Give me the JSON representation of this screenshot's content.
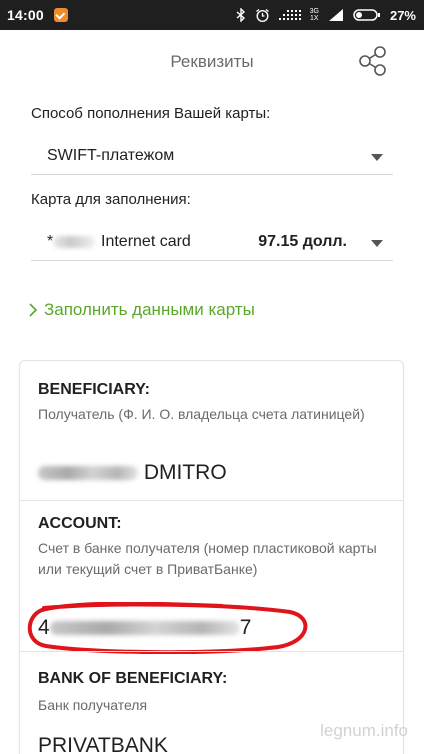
{
  "status_bar": {
    "time": "14:00",
    "network_top": "3G",
    "network_bottom": "1X",
    "battery": "27%"
  },
  "header": {
    "title": "Реквизиты"
  },
  "form": {
    "method_label": "Способ пополнения Вашей карты:",
    "method_value": "SWIFT-платежом",
    "card_label": "Карта для заполнения:",
    "card_prefix": "*",
    "card_name": "Internet card",
    "card_amount": "97.15 долл."
  },
  "fill_link": {
    "label": "Заполнить данными карты"
  },
  "details": {
    "beneficiary": {
      "title": "BENEFICIARY:",
      "description": "Получатель (Ф. И. О. владельца счета латиницей)",
      "value": "DMITRO"
    },
    "account": {
      "title": "ACCOUNT:",
      "description": "Счет в банке получателя (номер пластиковой карты или текущий счет в ПриватБанке)",
      "value_first": "4",
      "value_last": "7"
    },
    "bank": {
      "title": "BANK OF BENEFICIARY:",
      "description": "Банк получателя",
      "value": "PRIVATBANK"
    }
  },
  "watermark": "legnum.info",
  "colors": {
    "status_bar": "#1f1f1f",
    "accent_green": "#5aa72a",
    "highlight_red": "#e0151b"
  }
}
